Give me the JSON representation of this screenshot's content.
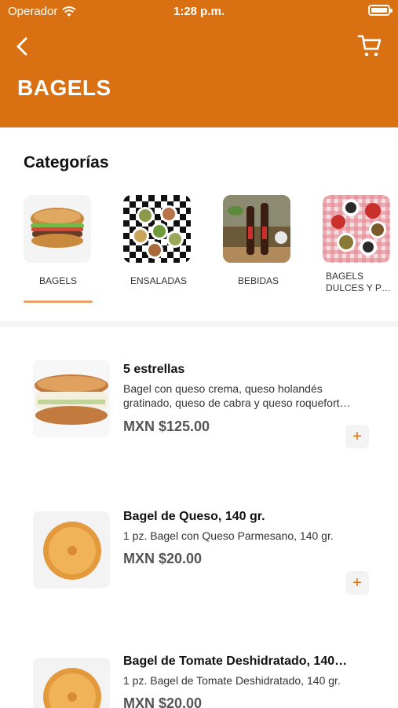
{
  "status_bar": {
    "carrier": "Operador",
    "time": "1:28 p.m."
  },
  "header": {
    "title": "BAGELS",
    "back_icon": "chevron-left-icon",
    "cart_icon": "cart-icon",
    "color": "#d97112"
  },
  "categories": {
    "title": "Categorías",
    "items": [
      {
        "label": "BAGELS",
        "selected": true
      },
      {
        "label": "ENSALADAS",
        "selected": false
      },
      {
        "label": "BEBIDAS",
        "selected": false
      },
      {
        "label": "BAGELS DULCES Y P…",
        "selected": false
      }
    ]
  },
  "products": [
    {
      "name": "5 estrellas",
      "description": "Bagel con queso crema, queso holandés gratinado, queso de cabra y queso roquefort…",
      "price": "MXN $125.00",
      "add": "+"
    },
    {
      "name": "Bagel de Queso, 140 gr.",
      "description": "1 pz. Bagel con Queso Parmesano, 140 gr.",
      "price": "MXN $20.00",
      "add": "+"
    },
    {
      "name": "Bagel de Tomate Deshidratado, 140…",
      "description": "1 pz. Bagel de Tomate Deshidratado, 140 gr.",
      "price": "MXN $20.00",
      "add": "+"
    }
  ]
}
